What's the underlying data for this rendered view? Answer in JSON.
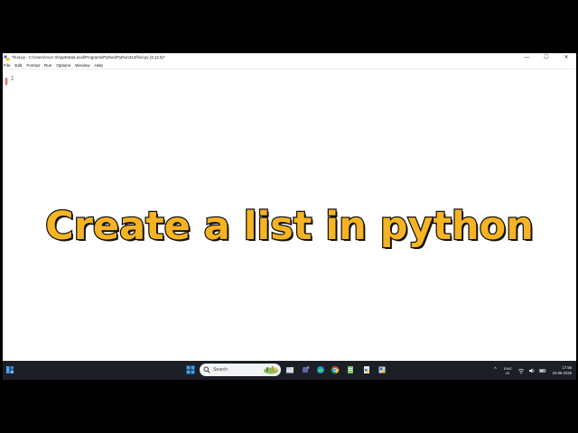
{
  "window": {
    "title": "*fruit.py - C:/Users/Acer 3/AppData/Local/Programs/Python/Python312/fruit.py (3.12.5)*",
    "controls": {
      "minimize": "—",
      "maximize": "☐",
      "close": "✕"
    }
  },
  "menu": [
    "File",
    "Edit",
    "Format",
    "Run",
    "Options",
    "Window",
    "Help"
  ],
  "editor": {
    "caret": "I"
  },
  "overlay": {
    "title": "Create a list in python",
    "color": "#f6b323",
    "outline": "#111111"
  },
  "taskbar": {
    "search_label": "Search",
    "apps": [
      "start-icon",
      "file-explorer-icon",
      "teams-icon",
      "edge-icon",
      "chrome-icon",
      "notepad-icon",
      "python-idle-icon",
      "python-file-icon"
    ],
    "tray": {
      "chevron": "^",
      "lang_line1": "ENG",
      "lang_line2": "IN",
      "icons": [
        "wifi-icon",
        "volume-icon",
        "battery-icon"
      ]
    },
    "clock": {
      "time": "17:56",
      "date": "24-06-2025"
    },
    "background": "#1c1f26"
  }
}
